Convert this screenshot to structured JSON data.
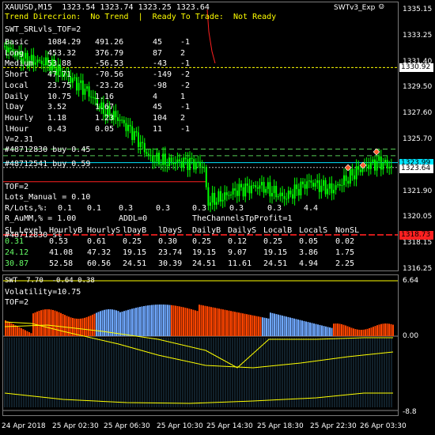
{
  "header": {
    "symbol_line": "XAUUSD,M15  1323.54 1323.74 1323.25 1323.64",
    "trend_line": "Trend Direcrion:  No Trend  |  Ready To Trade:  Not Ready",
    "expert_name": "SWTv3_Exp",
    "panel_title": "SWT_SRLvls_TOF=2"
  },
  "stats_table": {
    "rows": [
      {
        "label": "Basic",
        "a": "1084.29",
        "b": "491.26",
        "c": "45",
        "d": "-1"
      },
      {
        "label": "Long",
        "a": "453.32",
        "b": "376.79",
        "c": "87",
        "d": "2"
      },
      {
        "label": "Medium",
        "a": "53.88",
        "b": "-56.53",
        "c": "-43",
        "d": "-1"
      },
      {
        "label": "Short",
        "a": "47.71",
        "b": "-70.56",
        "c": "-149",
        "d": "-2"
      },
      {
        "label": "Local",
        "a": "23.75",
        "b": "-23.26",
        "c": "-98",
        "d": "-2"
      },
      {
        "label": "Daily",
        "a": "10.75",
        "b": "1.16",
        "c": "4",
        "d": "1"
      },
      {
        "label": "lDay",
        "a": "3.52",
        "b": "1.67",
        "c": "45",
        "d": "-1"
      },
      {
        "label": "Hourly",
        "a": "1.18",
        "b": "1.23",
        "c": "104",
        "d": "2"
      },
      {
        "label": "lHour",
        "a": "0.43",
        "b": "0.05",
        "c": "11",
        "d": "-1"
      }
    ]
  },
  "chart_labels": {
    "v_label": "V=2.31",
    "order1": "#48712830 buy 0.45",
    "order2": "#48712541 buy 0.59",
    "tof": "TOF=2",
    "lots_manual": "Lots_Manual = 0.10",
    "rlots_label": "R/Lots,%:",
    "rlots_values": [
      "0.1",
      "0.1",
      "0.3",
      "0.3",
      "0.3",
      "0.3",
      "0.3",
      "4.4"
    ],
    "raumm": "R_AuMM,% = 1.00",
    "addl": "ADDL=0",
    "channel_profit": "TheChannelsTpProfit=1",
    "order3": "#48712830 sl",
    "sl_header": [
      "SL_Level",
      "HourlyB",
      "HourlyS",
      "lDayB",
      "lDayS",
      "DailyB",
      "DailyS",
      "LocalB",
      "LocalS",
      "NonSL"
    ],
    "sl_row1": [
      "0.31",
      "0.53",
      "0.61",
      "0.25",
      "0.30",
      "0.25",
      "0.12",
      "0.25",
      "0.05",
      "0.02"
    ],
    "sl_row2": [
      "24.12",
      "41.08",
      "47.32",
      "19.15",
      "23.74",
      "19.15",
      "9.07",
      "19.15",
      "3.86",
      "1.75"
    ],
    "sl_row3": [
      "30.87",
      "52.58",
      "60.56",
      "24.51",
      "30.39",
      "24.51",
      "11.61",
      "24.51",
      "4.94",
      "2.25"
    ]
  },
  "price_axis": {
    "ticks": [
      "1335.15",
      "1333.25",
      "1331.40",
      "1329.50",
      "1327.60",
      "1325.70",
      "1323.80",
      "1321.90",
      "1320.05",
      "1318.15",
      "1316.25"
    ],
    "tag_current": "1323.64",
    "tag_upper": "1330.92",
    "tag_cyan": "1323.99",
    "tag_red": "1318.73"
  },
  "indicator": {
    "title": "SWT  7.70  -0.64 0.38",
    "volatility": "Volatility=10.75",
    "tof": "TOF=2",
    "axis_top": "6.64",
    "axis_mid": "0.00",
    "axis_bottom": "-8.8"
  },
  "time_axis": {
    "labels": [
      "24 Apr 2018",
      "25 Apr 02:30",
      "25 Apr 06:30",
      "25 Apr 10:30",
      "25 Apr 14:30",
      "25 Apr 18:30",
      "25 Apr 22:30",
      "26 Apr 03:30"
    ]
  },
  "colors": {
    "candle": "#00ff00",
    "level_yellow": "#ffff00",
    "level_green": "#55cc55",
    "level_cyan": "#00e5ff",
    "level_red": "#ff2020",
    "bars_orange": "#ff4500",
    "bars_blue": "#6fa8ff"
  }
}
